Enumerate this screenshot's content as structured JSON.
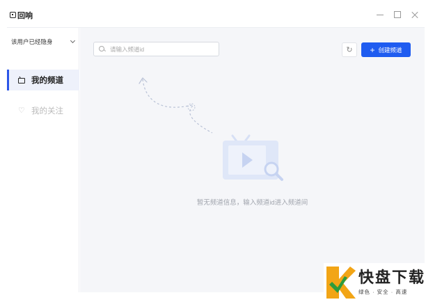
{
  "window": {
    "title": "回响"
  },
  "sidebar": {
    "user_status": "该用户已经隐身",
    "items": [
      {
        "label": "我的频道",
        "icon": "tv-icon",
        "active": true
      },
      {
        "label": "我的关注",
        "icon": "heart-icon",
        "active": false
      }
    ]
  },
  "toolbar": {
    "search_placeholder": "请输入频道id",
    "search_value": "",
    "refresh_icon": "refresh-icon",
    "create_label": "创建频道"
  },
  "empty_state": {
    "message": "暂无频道信息，输入频道id进入频道间"
  },
  "watermark": {
    "brand": "快盘下载",
    "tagline": "绿色 · 安全 · 高速"
  },
  "colors": {
    "accent": "#1f5cf0",
    "sidebar_active_bg": "#eef1fb",
    "main_bg": "#f5f6f9"
  }
}
